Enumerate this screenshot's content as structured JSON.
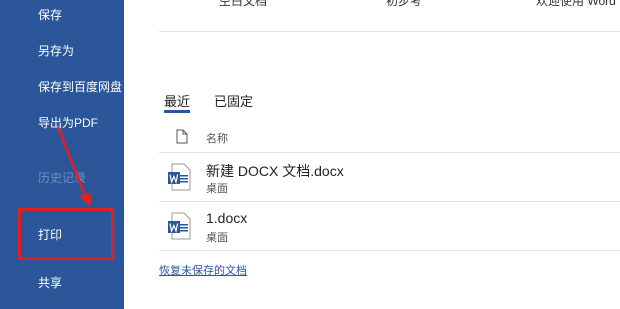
{
  "sidebar": {
    "items": [
      {
        "label": "保存"
      },
      {
        "label": "另存为"
      },
      {
        "label": "保存到百度网盘"
      },
      {
        "label": "导出为PDF"
      },
      {
        "label": "历史记录"
      },
      {
        "label": "打印"
      },
      {
        "label": "共享"
      }
    ]
  },
  "templates": {
    "items": [
      "空白文档",
      "初步考",
      "欢迎使用 Word"
    ]
  },
  "tabs": [
    {
      "label": "最近"
    },
    {
      "label": "已固定"
    }
  ],
  "list": {
    "header_name": "名称",
    "files": [
      {
        "name": "新建 DOCX 文档.docx",
        "location": "桌面"
      },
      {
        "name": "1.docx",
        "location": "桌面"
      }
    ]
  },
  "recover_link": "恢复未保存的文档",
  "colors": {
    "sidebar": "#2b579a",
    "highlight": "#e02020",
    "word_blue": "#2b579a"
  }
}
